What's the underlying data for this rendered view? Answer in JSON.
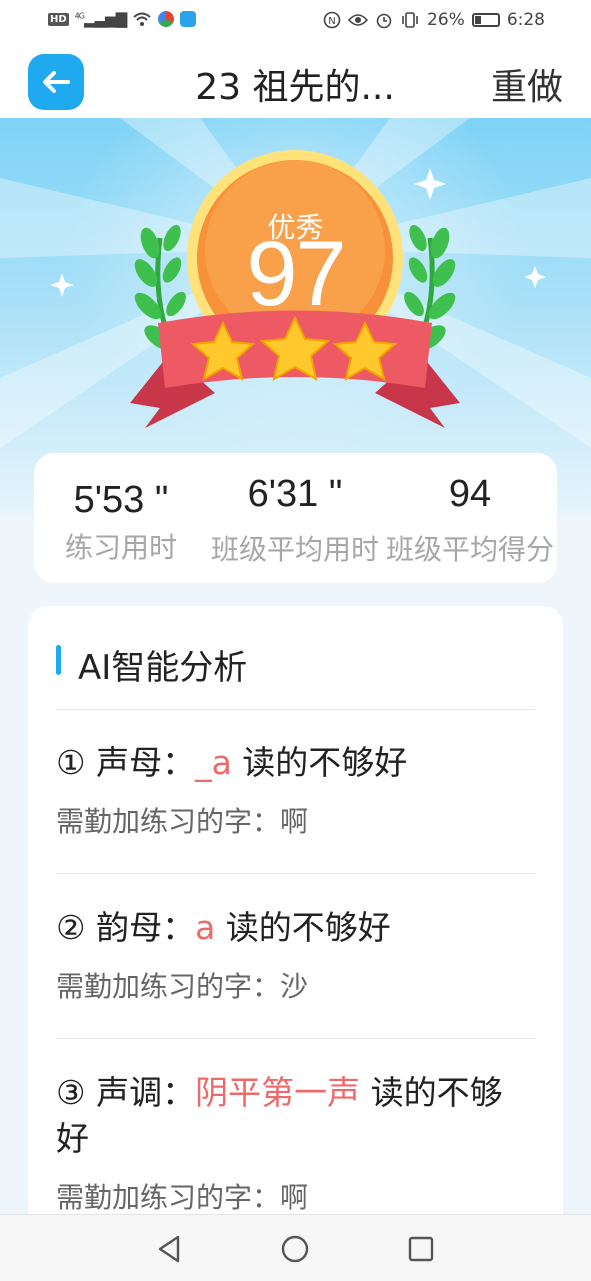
{
  "status_bar": {
    "network": "HD",
    "signal": "4G",
    "battery_percent": "26%",
    "time": "6:28"
  },
  "header": {
    "title": "23 祖先的...",
    "redo_label": "重做"
  },
  "result": {
    "grade": "优秀",
    "score": "97",
    "stars": 3
  },
  "stats": [
    {
      "value": "5'53 \"",
      "label": "练习用时"
    },
    {
      "value": "6'31 \"",
      "label": "班级平均用时"
    },
    {
      "value": "94",
      "label": "班级平均得分"
    }
  ],
  "analysis": {
    "title": "AI智能分析",
    "items": [
      {
        "prefix": "① 声母：",
        "highlight": "_a",
        "suffix": " 读的不够好",
        "sub": "需勤加练习的字：啊"
      },
      {
        "prefix": "② 韵母：",
        "highlight": "a",
        "suffix": " 读的不够好",
        "sub": "需勤加练习的字：沙"
      },
      {
        "prefix": "③ 声调：",
        "highlight": "阴平第一声",
        "suffix": " 读的不够好",
        "sub": "需勤加练习的字：啊"
      }
    ]
  },
  "colors": {
    "accent": "#1fa9ee",
    "highlight": "#ec6a6a",
    "medal_orange": "#f7913a",
    "ribbon": "#ee5a63",
    "star": "#ffc82c"
  }
}
